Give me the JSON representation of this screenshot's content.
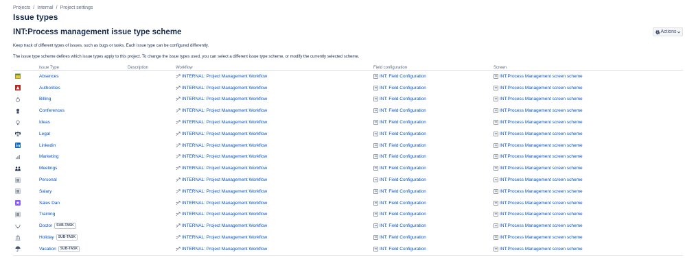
{
  "breadcrumb": {
    "items": [
      "Projects",
      "Internal",
      "Project settings"
    ],
    "separator": "/"
  },
  "page_title": "Issue types",
  "scheme_title": "INT:Process management issue type scheme",
  "actions": {
    "label": "Actions",
    "icon": "gear-icon"
  },
  "description": {
    "line1": "Keep track of different types of issues, such as bugs or tasks. Each issue type can be configured differently.",
    "line2": "The issue type scheme defines which issue types apply to this project. To change the issue types used, you can select a different issue type scheme, or modify the currently selected scheme."
  },
  "table": {
    "headers": {
      "issue_type": "Issue Type",
      "description": "Description",
      "workflow": "Workflow",
      "field_configuration": "Field configuration",
      "screen": "Screen"
    },
    "rows": [
      {
        "name": "Absences",
        "icon": "calendar-icon",
        "icon_color": "#5e8c31",
        "badge": "",
        "description": "",
        "workflow": "INTERNAL: Project Management Workflow",
        "field_configuration": "INT: Field Configuration",
        "screen": "INT:Process Management screen scheme"
      },
      {
        "name": "Authorities",
        "icon": "building-icon",
        "icon_color": "#b3261e",
        "badge": "",
        "description": "",
        "workflow": "INTERNAL: Project Management Workflow",
        "field_configuration": "INT: Field Configuration",
        "screen": "INT:Process Management screen scheme"
      },
      {
        "name": "Billing",
        "icon": "money-bag-icon",
        "icon_color": "#6b778c",
        "badge": "",
        "description": "",
        "workflow": "INTERNAL: Project Management Workflow",
        "field_configuration": "INT: Field Configuration",
        "screen": "INT:Process Management screen scheme"
      },
      {
        "name": "Conferences",
        "icon": "badge-icon",
        "icon_color": "#42526e",
        "badge": "",
        "description": "",
        "workflow": "INTERNAL: Project Management Workflow",
        "field_configuration": "INT: Field Configuration",
        "screen": "INT:Process Management screen scheme"
      },
      {
        "name": "Ideas",
        "icon": "lightbulb-icon",
        "icon_color": "#6b778c",
        "badge": "",
        "description": "",
        "workflow": "INTERNAL: Project Management Workflow",
        "field_configuration": "INT: Field Configuration",
        "screen": "INT:Process Management screen scheme"
      },
      {
        "name": "Legal",
        "icon": "scales-icon",
        "icon_color": "#172b4d",
        "badge": "",
        "description": "",
        "workflow": "INTERNAL: Project Management Workflow",
        "field_configuration": "INT: Field Configuration",
        "screen": "INT:Process Management screen scheme"
      },
      {
        "name": "Linkedin",
        "icon": "linkedin-icon",
        "icon_color": "#0a66c2",
        "badge": "",
        "description": "",
        "workflow": "INTERNAL: Project Management Workflow",
        "field_configuration": "INT: Field Configuration",
        "screen": "INT:Process Management screen scheme"
      },
      {
        "name": "Marketing",
        "icon": "bar-chart-icon",
        "icon_color": "#6b778c",
        "badge": "",
        "description": "",
        "workflow": "INTERNAL: Project Management Workflow",
        "field_configuration": "INT: Field Configuration",
        "screen": "INT:Process Management screen scheme"
      },
      {
        "name": "Meetings",
        "icon": "people-icon",
        "icon_color": "#172b4d",
        "badge": "",
        "description": "",
        "workflow": "INTERNAL: Project Management Workflow",
        "field_configuration": "INT: Field Configuration",
        "screen": "INT:Process Management screen scheme"
      },
      {
        "name": "Personal",
        "icon": "square-icon",
        "icon_color": "#8993a4",
        "badge": "",
        "description": "",
        "workflow": "INTERNAL: Project Management Workflow",
        "field_configuration": "INT: Field Configuration",
        "screen": "INT:Process Management screen scheme"
      },
      {
        "name": "Salary",
        "icon": "square-icon",
        "icon_color": "#8993a4",
        "badge": "",
        "description": "",
        "workflow": "INTERNAL: Project Management Workflow",
        "field_configuration": "INT: Field Configuration",
        "screen": "INT:Process Management screen scheme"
      },
      {
        "name": "Sales Dan",
        "icon": "purple-square-icon",
        "icon_color": "#8b5cf6",
        "badge": "",
        "description": "",
        "workflow": "INTERNAL: Project Management Workflow",
        "field_configuration": "INT: Field Configuration",
        "screen": "INT:Process Management screen scheme"
      },
      {
        "name": "Training",
        "icon": "square-icon",
        "icon_color": "#8993a4",
        "badge": "",
        "description": "",
        "workflow": "INTERNAL: Project Management Workflow",
        "field_configuration": "INT: Field Configuration",
        "screen": "INT:Process Management screen scheme"
      },
      {
        "name": "Doctor",
        "icon": "stethoscope-icon",
        "icon_color": "#6b778c",
        "badge": "SUB-TASK",
        "description": "",
        "workflow": "INTERNAL: Project Management Workflow",
        "field_configuration": "INT: Field Configuration",
        "screen": "INT:Process Management screen scheme"
      },
      {
        "name": "Holiday",
        "icon": "bank-icon",
        "icon_color": "#6b778c",
        "badge": "SUB-TASK",
        "description": "",
        "workflow": "INTERNAL: Project Management Workflow",
        "field_configuration": "INT: Field Configuration",
        "screen": "INT:Process Management screen scheme"
      },
      {
        "name": "Vacation",
        "icon": "umbrella-icon",
        "icon_color": "#42526e",
        "badge": "SUB-TASK",
        "description": "",
        "workflow": "INTERNAL: Project Management Workflow",
        "field_configuration": "INT: Field Configuration",
        "screen": "INT:Process Management screen scheme"
      }
    ]
  },
  "colors": {
    "link": "#0052cc",
    "text": "#172b4d",
    "muted": "#5e6c84",
    "border": "#dfe1e6"
  }
}
